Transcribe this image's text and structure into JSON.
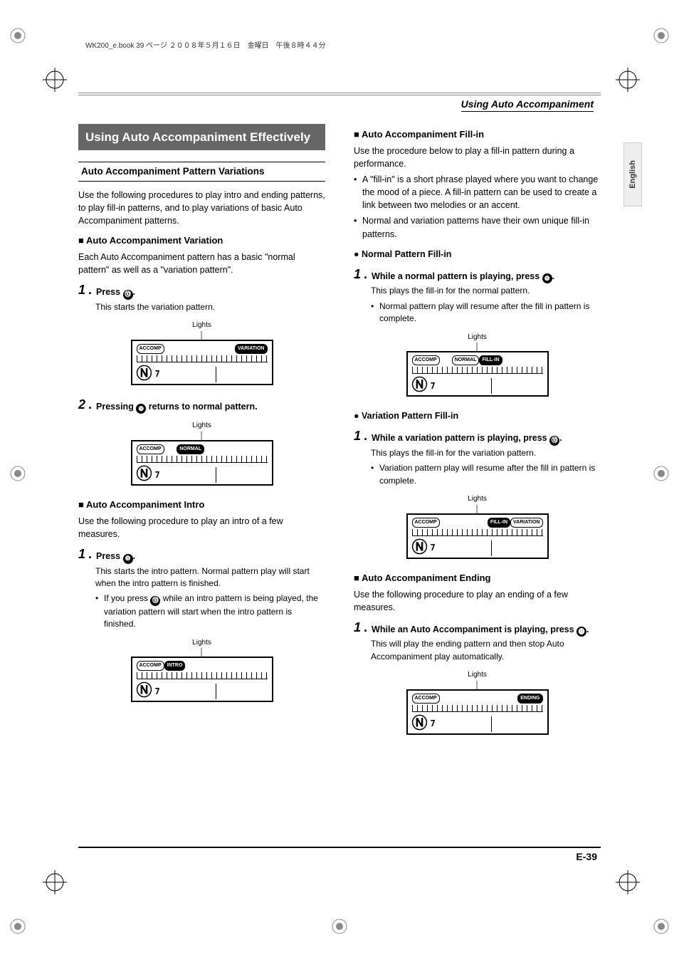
{
  "header_line": "WK200_e.book  39 ページ  ２００８年５月１６日　金曜日　午後８時４４分",
  "running_head": "Using Auto Accompaniment",
  "side_tab": "English",
  "page_number": "E-39",
  "lights_label": "Lights",
  "seven_label": "7",
  "left": {
    "block_title": "Using Auto Accompaniment Effectively",
    "sub1": "Auto Accompaniment Pattern Variations",
    "p1": "Use the following procedures to play intro and ending patterns, to play fill-in patterns, and to play variations of basic Auto Accompaniment patterns.",
    "sq1": "Auto Accompaniment Variation",
    "p2": "Each Auto Accompaniment pattern has a basic \"normal pattern\" as well as a \"variation pattern\".",
    "step1_pre": "Press ",
    "step1_ref": "⓾",
    "step1_post": ".",
    "step1_detail": "This starts the variation pattern.",
    "diag1_left": "ACCOMP",
    "diag1_right": "VARIATION",
    "step2_pre": "Pressing ",
    "step2_ref": "❾",
    "step2_post": " returns to normal pattern.",
    "diag2_left": "ACCOMP",
    "diag2_right": "NORMAL",
    "sq2": "Auto Accompaniment Intro",
    "p3": "Use the following procedure to play an intro of a few measures.",
    "step3_pre": "Press ",
    "step3_ref": "❽",
    "step3_post": ".",
    "step3_detail": "This starts the intro pattern. Normal pattern play will start when the intro pattern is finished.",
    "step3_b_pre": "If you press ",
    "step3_b_ref": "⓾",
    "step3_b_post": " while an intro pattern is being played, the variation pattern will start when the intro pattern is finished.",
    "diag3_left": "ACCOMP",
    "diag3_right": "INTRO"
  },
  "right": {
    "sq1": "Auto Accompaniment Fill-in",
    "p1": "Use the procedure below to play a fill-in pattern during a performance.",
    "b1": "A \"fill-in\" is a short phrase played where you want to change the mood of a piece. A fill-in pattern can be used to create a link between two melodies or an accent.",
    "b2": "Normal and variation patterns have their own unique fill-in patterns.",
    "dot1": "Normal Pattern Fill-in",
    "step1_pre": "While a normal pattern is playing, press ",
    "step1_ref": "❾",
    "step1_post": ".",
    "step1_detail": "This plays the fill-in for the normal pattern.",
    "step1_b": "Normal pattern play will resume after the fill in pattern is complete.",
    "diag1_left": "ACCOMP",
    "diag1_mid": "NORMAL",
    "diag1_right": "FILL-IN",
    "dot2": "Variation Pattern Fill-in",
    "step2_pre": "While a variation pattern is playing, press ",
    "step2_ref": "⓾",
    "step2_post": ".",
    "step2_detail": "This plays the fill-in for the variation pattern.",
    "step2_b": "Variation pattern play will resume after the fill in pattern is complete.",
    "diag2_left": "ACCOMP",
    "diag2_mid": "FILL-IN",
    "diag2_right": "VARIATION",
    "sq2": "Auto Accompaniment Ending",
    "p2": "Use the following procedure to play an ending of a few measures.",
    "step3_pre": "While an Auto Accompaniment is playing, press ",
    "step3_ref": "⓫",
    "step3_post": ".",
    "step3_detail": "This will play the ending pattern and then stop Auto Accompaniment play automatically.",
    "diag3_left": "ACCOMP",
    "diag3_right": "ENDING"
  }
}
